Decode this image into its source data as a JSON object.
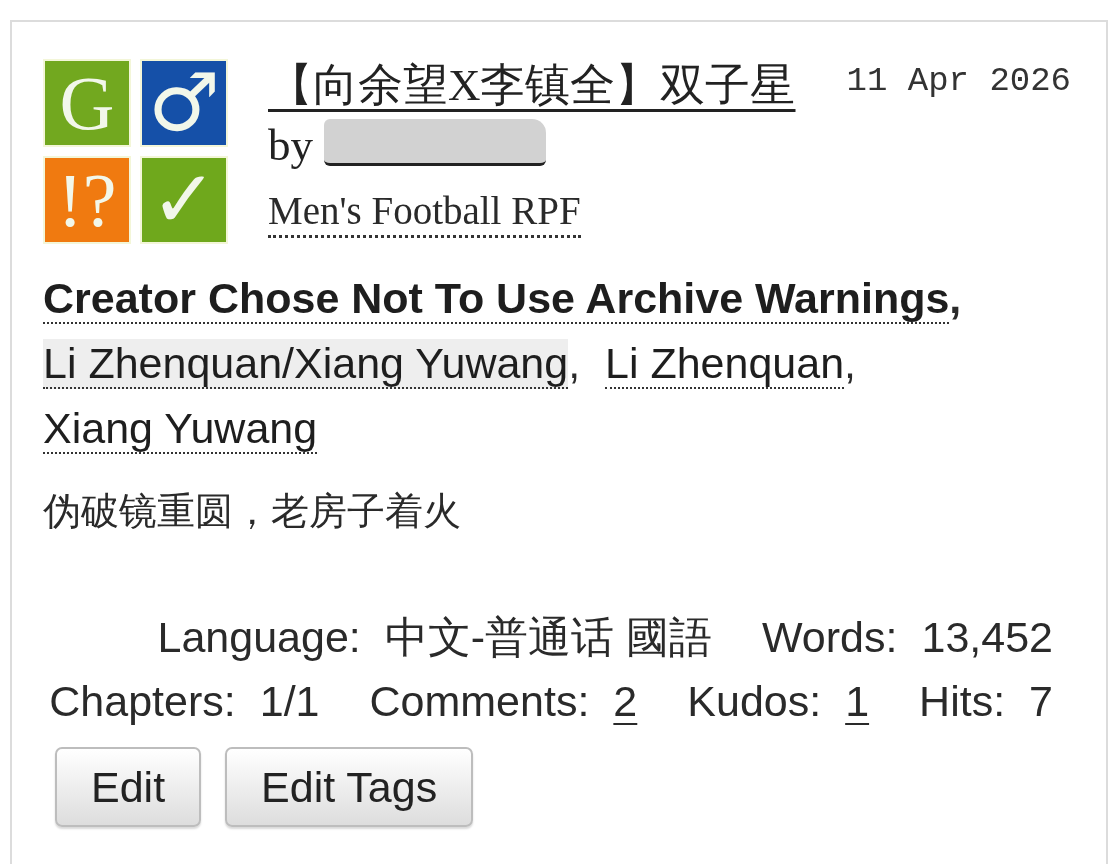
{
  "required_tags": [
    {
      "symbol": "G",
      "color": "#72a81f"
    },
    {
      "symbol": "♂",
      "color": "#1550a8"
    },
    {
      "symbol": "!?",
      "color": "#f07a10"
    },
    {
      "symbol": "✓",
      "color": "#6fa81c"
    }
  ],
  "heading": {
    "title": "【向余望X李镇全】双子星",
    "by": "by",
    "author_redacted": true
  },
  "date": "11 Apr 2026",
  "fandom": "Men's Football RPF",
  "tags": {
    "separator": ",",
    "items": [
      {
        "kind": "warning",
        "label": "Creator Chose Not To Use Archive Warnings"
      },
      {
        "kind": "relationship",
        "label": "Li Zhenquan/Xiang Yuwang"
      },
      {
        "kind": "character",
        "label": "Li Zhenquan"
      },
      {
        "kind": "character",
        "label": "Xiang Yuwang"
      }
    ]
  },
  "summary": "伪破镜重圆，老房子着火",
  "stats": [
    [
      {
        "label": "Language:",
        "value": "中文-普通话 國語",
        "linked": false
      },
      {
        "label": "Words:",
        "value": "13,452",
        "linked": false
      }
    ],
    [
      {
        "label": "Chapters:",
        "value": "1/1",
        "linked": false
      },
      {
        "label": "Comments:",
        "value": "2",
        "linked": true
      },
      {
        "label": "Kudos:",
        "value": "1",
        "linked": true
      },
      {
        "label": "Hits:",
        "value": "7",
        "linked": false
      }
    ]
  ],
  "buttons": [
    {
      "label": "Edit"
    },
    {
      "label": "Edit Tags"
    }
  ]
}
